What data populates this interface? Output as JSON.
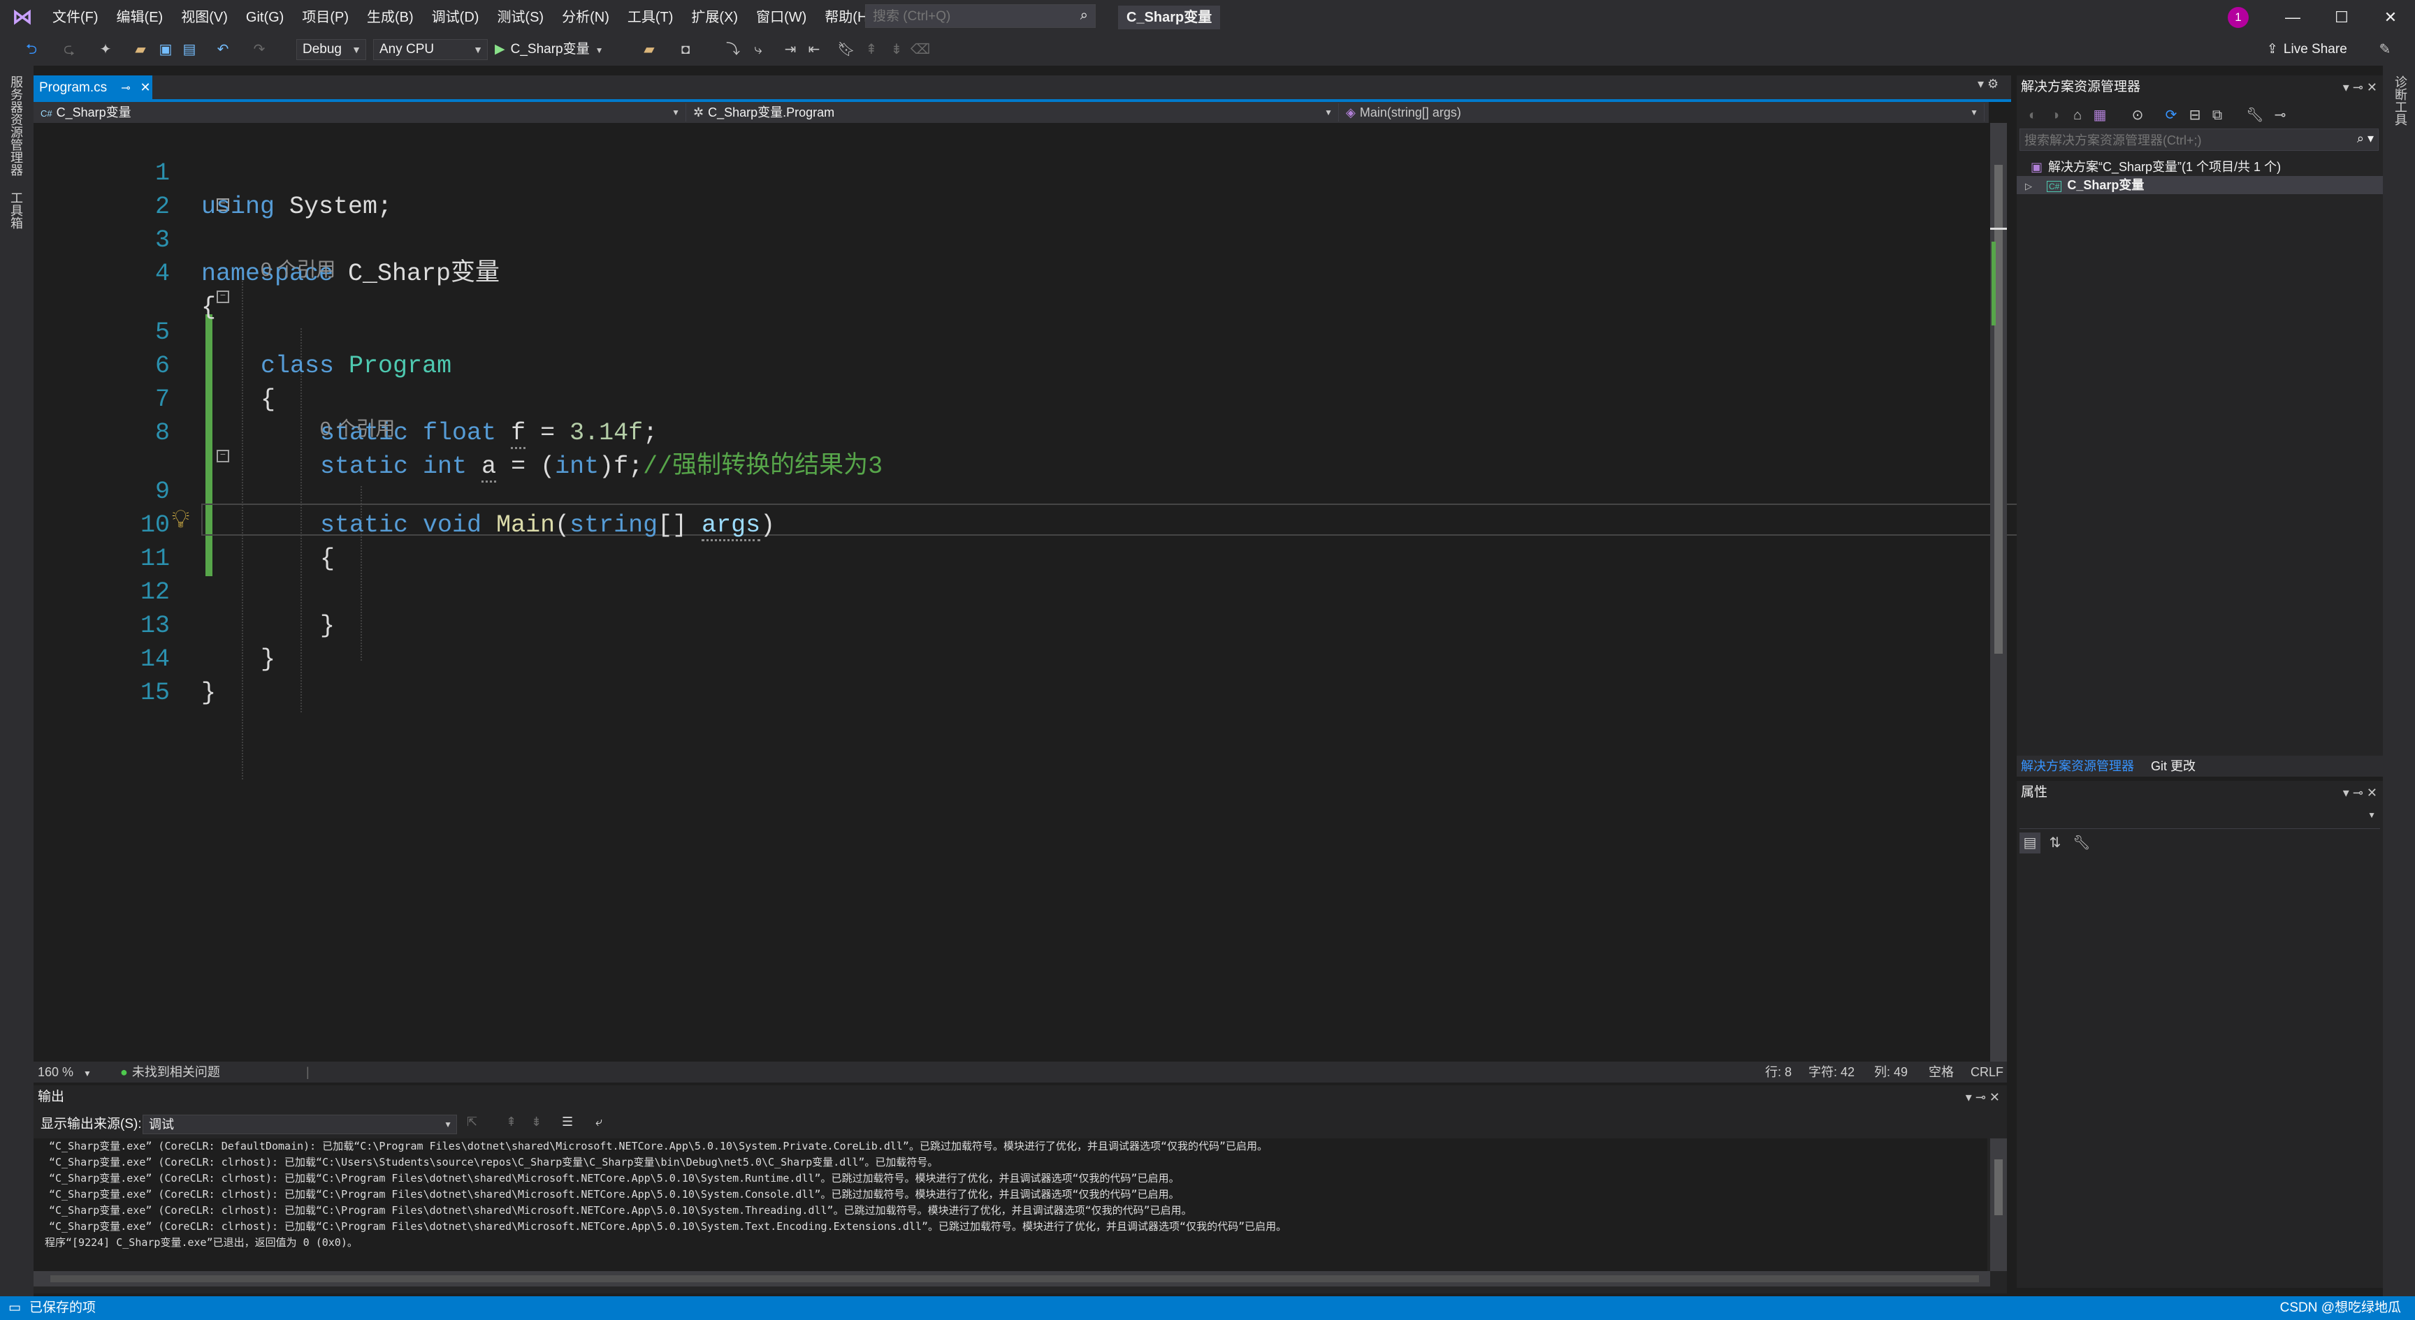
{
  "window": {
    "menu": [
      "文件(F)",
      "编辑(E)",
      "视图(V)",
      "Git(G)",
      "项目(P)",
      "生成(B)",
      "调试(D)",
      "测试(S)",
      "分析(N)",
      "工具(T)",
      "扩展(X)",
      "窗口(W)",
      "帮助(H)"
    ],
    "search_placeholder": "搜索 (Ctrl+Q)",
    "solution_name": "C_Sharp变量",
    "notification_count": "1",
    "accent": "#007acc"
  },
  "toolbar": {
    "config": "Debug",
    "platform": "Any CPU",
    "run_label": "C_Sharp变量",
    "live_share": "Live Share"
  },
  "left_strip": {
    "tab1": "服务器资源管理器",
    "tab2": "工具箱"
  },
  "right_strip": {
    "tab1": "诊断工具"
  },
  "editor": {
    "tab_label": "Program.cs",
    "tab_pin": "⊸",
    "nav": [
      "C_Sharp变量",
      "C_Sharp变量.Program",
      "Main(string[] args)"
    ],
    "codelens": [
      "0 个引用",
      "0 个引用"
    ],
    "line_numbers": [
      "1",
      "2",
      "3",
      "4",
      "5",
      "6",
      "7",
      "8",
      "9",
      "10",
      "11",
      "12",
      "13",
      "14",
      "15"
    ],
    "code": {
      "l1_kw": "using",
      "l1_rest": " System;",
      "l3_kw": "namespace",
      "l3_rest": " C_Sharp变量",
      "brace_open": "{",
      "brace_close": "}",
      "l5_kw": "class",
      "l5_type": "Program",
      "kw_static": "static",
      "kw_float": "float",
      "var_f": "f",
      "l7_eq": " = ",
      "l7_num": "3.14f",
      "semi": ";",
      "kw_int": "int",
      "var_a": "a",
      "l8_eq": " = (",
      "l8_cast": "int",
      "l8_rest": ")f;",
      "l8_comment": "//强制转换的结果为3",
      "kw_void": "void",
      "l9_method": "Main",
      "l9_paren": "(",
      "kw_string": "string",
      "l9_arr": "[] ",
      "l9_param": "args",
      "l9_close": ")"
    }
  },
  "editor_status": {
    "zoom": "160 %",
    "issues": "未找到相关问题",
    "line": "行: 8",
    "char": "字符: 42",
    "col": "列: 49",
    "spaces": "空格",
    "eol": "CRLF"
  },
  "output": {
    "title": "输出",
    "source_label": "显示输出来源(S):",
    "source_value": "调试",
    "lines": [
      "“C_Sharp变量.exe” (CoreCLR: DefaultDomain): 已加载“C:\\Program Files\\dotnet\\shared\\Microsoft.NETCore.App\\5.0.10\\System.Private.CoreLib.dll”。已跳过加载符号。模块进行了优化，并且调试器选项“仅我的代码”已启用。",
      "“C_Sharp变量.exe” (CoreCLR: clrhost): 已加载“C:\\Users\\Students\\source\\repos\\C_Sharp变量\\C_Sharp变量\\bin\\Debug\\net5.0\\C_Sharp变量.dll”。已加载符号。",
      "“C_Sharp变量.exe” (CoreCLR: clrhost): 已加载“C:\\Program Files\\dotnet\\shared\\Microsoft.NETCore.App\\5.0.10\\System.Runtime.dll”。已跳过加载符号。模块进行了优化，并且调试器选项“仅我的代码”已启用。",
      "“C_Sharp变量.exe” (CoreCLR: clrhost): 已加载“C:\\Program Files\\dotnet\\shared\\Microsoft.NETCore.App\\5.0.10\\System.Console.dll”。已跳过加载符号。模块进行了优化，并且调试器选项“仅我的代码”已启用。",
      "“C_Sharp变量.exe” (CoreCLR: clrhost): 已加载“C:\\Program Files\\dotnet\\shared\\Microsoft.NETCore.App\\5.0.10\\System.Threading.dll”。已跳过加载符号。模块进行了优化，并且调试器选项“仅我的代码”已启用。",
      "“C_Sharp变量.exe” (CoreCLR: clrhost): 已加载“C:\\Program Files\\dotnet\\shared\\Microsoft.NETCore.App\\5.0.10\\System.Text.Encoding.Extensions.dll”。已跳过加载符号。模块进行了优化，并且调试器选项“仅我的代码”已启用。",
      "程序“[9224] C_Sharp变量.exe”已退出，返回值为 0 (0x0)。"
    ]
  },
  "solution_explorer": {
    "title": "解决方案资源管理器",
    "search_placeholder": "搜索解决方案资源管理器(Ctrl+;)",
    "solution_node": "解决方案“C_Sharp变量”(1 个项目/共 1 个)",
    "project_node": "C_Sharp变量",
    "project_badge": "C#",
    "bottom_tabs": [
      "解决方案资源管理器",
      "Git 更改"
    ]
  },
  "properties": {
    "title": "属性"
  },
  "statusbar": {
    "left": "已保存的项",
    "right": "CSDN @想吃绿地瓜"
  }
}
